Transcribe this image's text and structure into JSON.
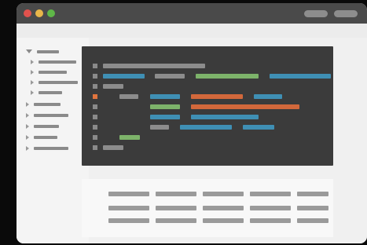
{
  "window": {
    "controls": [
      "close-dot",
      "minimize-dot",
      "maximize-dot"
    ],
    "colors": {
      "close": "#e0524d",
      "minimize": "#e8b64a",
      "maximize": "#5fb748",
      "titlebar": "#4a4a4a"
    }
  },
  "sidebar": {
    "tree": [
      {
        "expanded": true,
        "level": 0
      },
      {
        "expanded": false,
        "level": 1
      },
      {
        "expanded": false,
        "level": 1
      },
      {
        "expanded": false,
        "level": 1
      },
      {
        "expanded": false,
        "level": 1
      },
      {
        "expanded": false,
        "level": 0
      },
      {
        "expanded": false,
        "level": 0
      },
      {
        "expanded": false,
        "level": 0
      },
      {
        "expanded": false,
        "level": 0
      },
      {
        "expanded": false,
        "level": 0
      }
    ]
  },
  "editor": {
    "background": "#3b3b3b",
    "token_colors": {
      "gray": "#8c8c8c",
      "blue": "#3f8fb4",
      "green": "#7db36a",
      "orange": "#d2683b"
    },
    "active_line": 4,
    "line_count": 9
  },
  "panel": {
    "rows": 3,
    "columns": 5
  }
}
